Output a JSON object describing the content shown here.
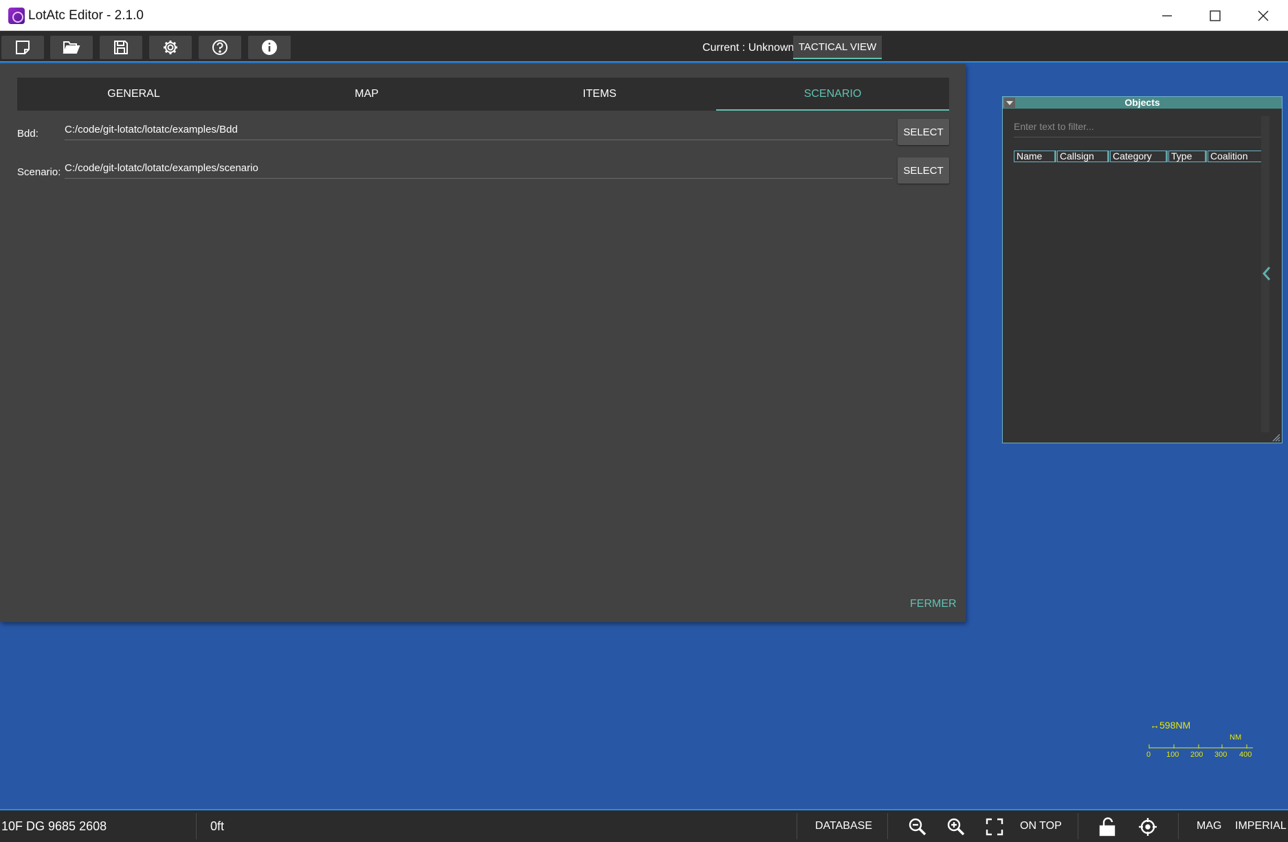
{
  "window": {
    "title": "LotAtc Editor - 2.1.0",
    "controls": [
      "minimize-icon",
      "maximize-icon",
      "close-icon"
    ]
  },
  "toolbar": {
    "buttons": [
      "new-icon",
      "open-folder-icon",
      "save-icon",
      "gear-icon",
      "help-icon",
      "info-icon"
    ],
    "current_label": "Current : Unknown",
    "tactical_view": "TACTICAL VIEW"
  },
  "dialog": {
    "tabs": [
      {
        "label": "GENERAL",
        "active": false
      },
      {
        "label": "MAP",
        "active": false
      },
      {
        "label": "ITEMS",
        "active": false
      },
      {
        "label": "SCENARIO",
        "active": true
      }
    ],
    "fields": [
      {
        "label": "Bdd:",
        "value": "C:/code/git-lotatc/lotatc/examples/Bdd",
        "button": "SELECT"
      },
      {
        "label": "Scenario:",
        "value": "C:/code/git-lotatc/lotatc/examples/scenario",
        "button": "SELECT"
      }
    ],
    "close_label": "FERMER"
  },
  "objects_panel": {
    "title": "Objects",
    "filter_placeholder": "Enter text to filter...",
    "columns": [
      "Name",
      "Callsign",
      "Category",
      "Type",
      "Coalition"
    ]
  },
  "scale": {
    "distance": "↔598NM",
    "unit": "NM",
    "ticks": [
      "0",
      "100",
      "200",
      "300",
      "400"
    ]
  },
  "statusbar": {
    "coordinates": "10F DG 9685 2608",
    "altitude": "0ft",
    "database": "DATABASE",
    "on_top": "ON TOP",
    "mag": "MAG",
    "imperial": "IMPERIAL"
  },
  "colors": {
    "map_background": "#2857a6",
    "accent": "#62c2b3",
    "scale": "#e8e800"
  }
}
